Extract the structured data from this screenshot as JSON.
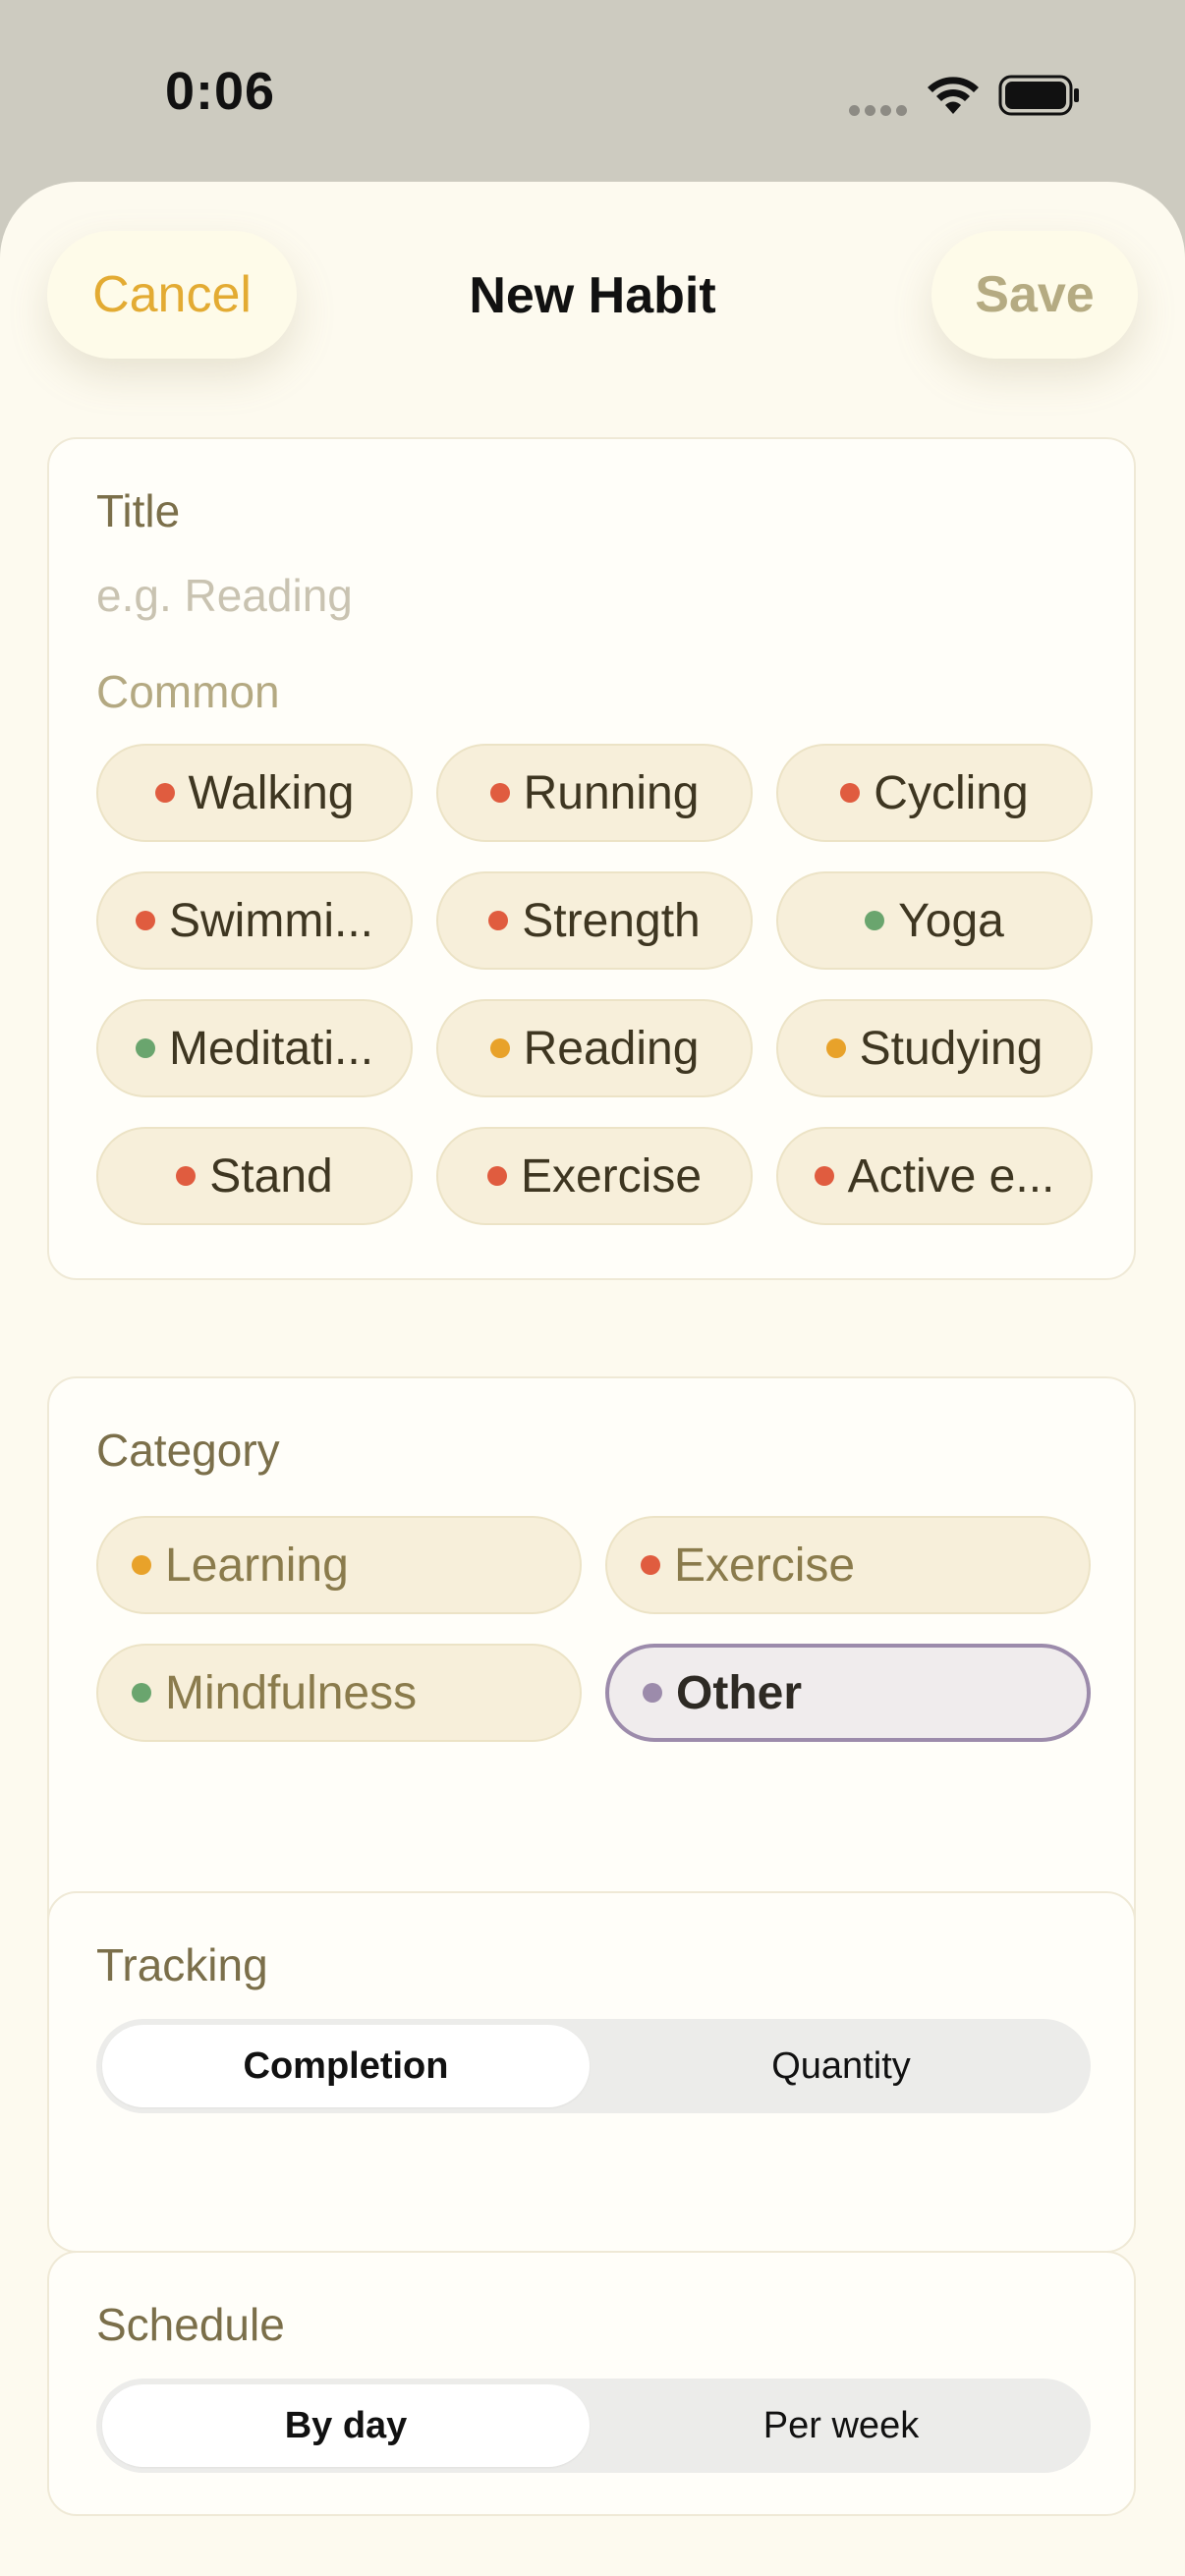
{
  "status_bar": {
    "time": "0:06"
  },
  "nav": {
    "cancel": "Cancel",
    "title": "New Habit",
    "save": "Save"
  },
  "title_section": {
    "label": "Title",
    "placeholder": "e.g. Reading",
    "common_label": "Common",
    "chips": [
      {
        "label": "Walking",
        "dot": "#e05c3f"
      },
      {
        "label": "Running",
        "dot": "#e05c3f"
      },
      {
        "label": "Cycling",
        "dot": "#e05c3f"
      },
      {
        "label": "Swimmi...",
        "dot": "#e05c3f"
      },
      {
        "label": "Strength",
        "dot": "#e05c3f"
      },
      {
        "label": "Yoga",
        "dot": "#6aa56e"
      },
      {
        "label": "Meditati...",
        "dot": "#6aa56e"
      },
      {
        "label": "Reading",
        "dot": "#e8a22a"
      },
      {
        "label": "Studying",
        "dot": "#e8a22a"
      },
      {
        "label": "Stand",
        "dot": "#e05c3f"
      },
      {
        "label": "Exercise",
        "dot": "#e05c3f"
      },
      {
        "label": "Active e...",
        "dot": "#e05c3f"
      }
    ]
  },
  "category_section": {
    "label": "Category",
    "chips": [
      {
        "label": "Learning",
        "dot": "#e8a22a"
      },
      {
        "label": "Exercise",
        "dot": "#e05c3f"
      },
      {
        "label": "Mindfulness",
        "dot": "#6aa56e"
      },
      {
        "label": "Other",
        "dot": "#9c8bab",
        "selected": true
      }
    ]
  },
  "tracking_section": {
    "label": "Tracking",
    "options": [
      "Completion",
      "Quantity"
    ],
    "selected": "Completion"
  },
  "schedule_section": {
    "label": "Schedule",
    "options": [
      "By day",
      "Per week"
    ],
    "selected": "By day"
  }
}
